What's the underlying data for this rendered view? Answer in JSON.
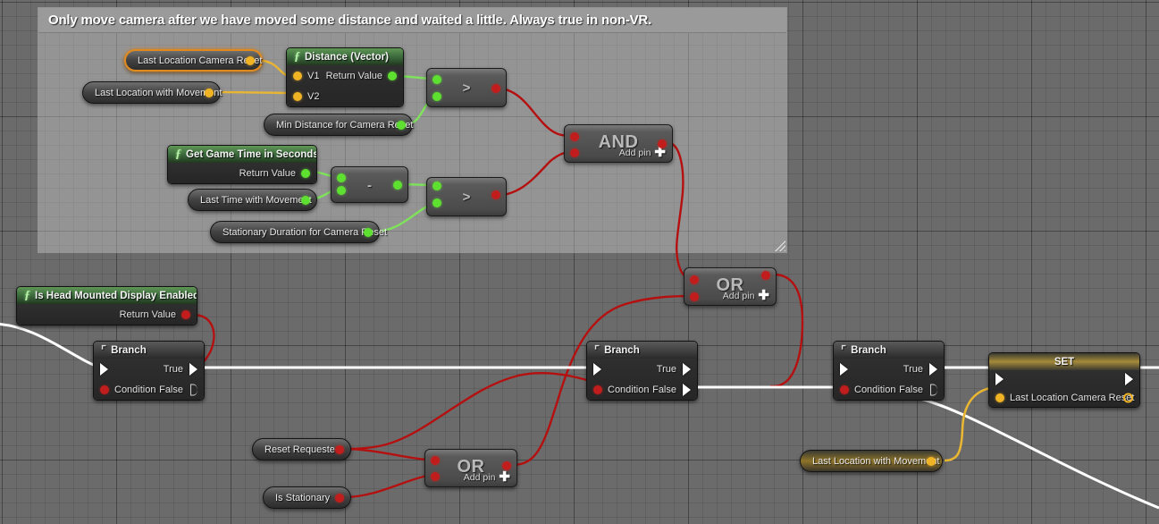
{
  "graph": {
    "background_color": "#6b6b6b",
    "exec_wire_color": "#ffffff",
    "bool_wire_color": "#b51010",
    "float_wire_color": "#7ee35b",
    "vector_wire_color": "#e8b633",
    "selected_node_color": "#e08a1e"
  },
  "comment": {
    "title": "Only move camera after we have moved some distance and waited a little.  Always true in non-VR.",
    "header_color": "#9a9a9a",
    "resize_handle": "resize-grip-icon"
  },
  "nodes": {
    "last_location_camera_reset_get": {
      "label": "Last Location Camera Reset",
      "pin_type": "vector",
      "selected": true
    },
    "last_location_with_movement_get": {
      "label": "Last Location with Movement",
      "pin_type": "vector"
    },
    "distance_vector": {
      "title": "Distance (Vector)",
      "glyph": "function-icon",
      "inputs": [
        "V1",
        "V2"
      ],
      "output": "Return Value"
    },
    "min_distance_for_camera_reset": {
      "label": "Min Distance for Camera Reset",
      "pin_type": "float"
    },
    "greater_than_distance": {
      "symbol": ">",
      "input_count": 2,
      "output_type": "bool"
    },
    "get_game_time_in_seconds": {
      "title": "Get Game Time in Seconds",
      "glyph": "function-icon",
      "output": "Return Value"
    },
    "last_time_with_movement": {
      "label": "Last Time with Movement",
      "pin_type": "float"
    },
    "stationary_duration_for_camera_reset": {
      "label": "Stationary Duration for Camera Reset",
      "pin_type": "float"
    },
    "subtract": {
      "symbol": "-",
      "input_count": 2,
      "output_type": "float"
    },
    "greater_than_time": {
      "symbol": ">",
      "input_count": 2,
      "output_type": "bool"
    },
    "and_node": {
      "title": "AND",
      "add_pin_label": "Add pin",
      "add_pin_glyph": "plus-icon",
      "input_count": 2
    },
    "or_node_top": {
      "title": "OR",
      "add_pin_label": "Add pin",
      "add_pin_glyph": "plus-icon",
      "input_count": 2
    },
    "or_node_bottom": {
      "title": "OR",
      "add_pin_label": "Add pin",
      "add_pin_glyph": "plus-icon",
      "input_count": 2
    },
    "is_head_mounted_display_enabled": {
      "title": "Is Head Mounted Display Enabled",
      "glyph": "function-icon",
      "output": "Return Value"
    },
    "branch_1": {
      "title": "Branch",
      "glyph": "branch-icon",
      "condition_label": "Condition",
      "true_label": "True",
      "false_label": "False",
      "true_connected": true,
      "false_connected": false
    },
    "branch_2": {
      "title": "Branch",
      "glyph": "branch-icon",
      "condition_label": "Condition",
      "true_label": "True",
      "false_label": "False",
      "true_connected": true,
      "false_connected": true
    },
    "branch_3": {
      "title": "Branch",
      "glyph": "branch-icon",
      "condition_label": "Condition",
      "true_label": "True",
      "false_label": "False",
      "true_connected": true,
      "false_connected": false
    },
    "reset_requested": {
      "label": "Reset Requested",
      "pin_type": "bool"
    },
    "is_stationary": {
      "label": "Is Stationary",
      "pin_type": "bool"
    },
    "last_location_with_movement_get2": {
      "label": "Last Location with Movement",
      "pin_type": "vector"
    },
    "set_node": {
      "title": "SET",
      "variable_label": "Last Location Camera Reset"
    }
  }
}
